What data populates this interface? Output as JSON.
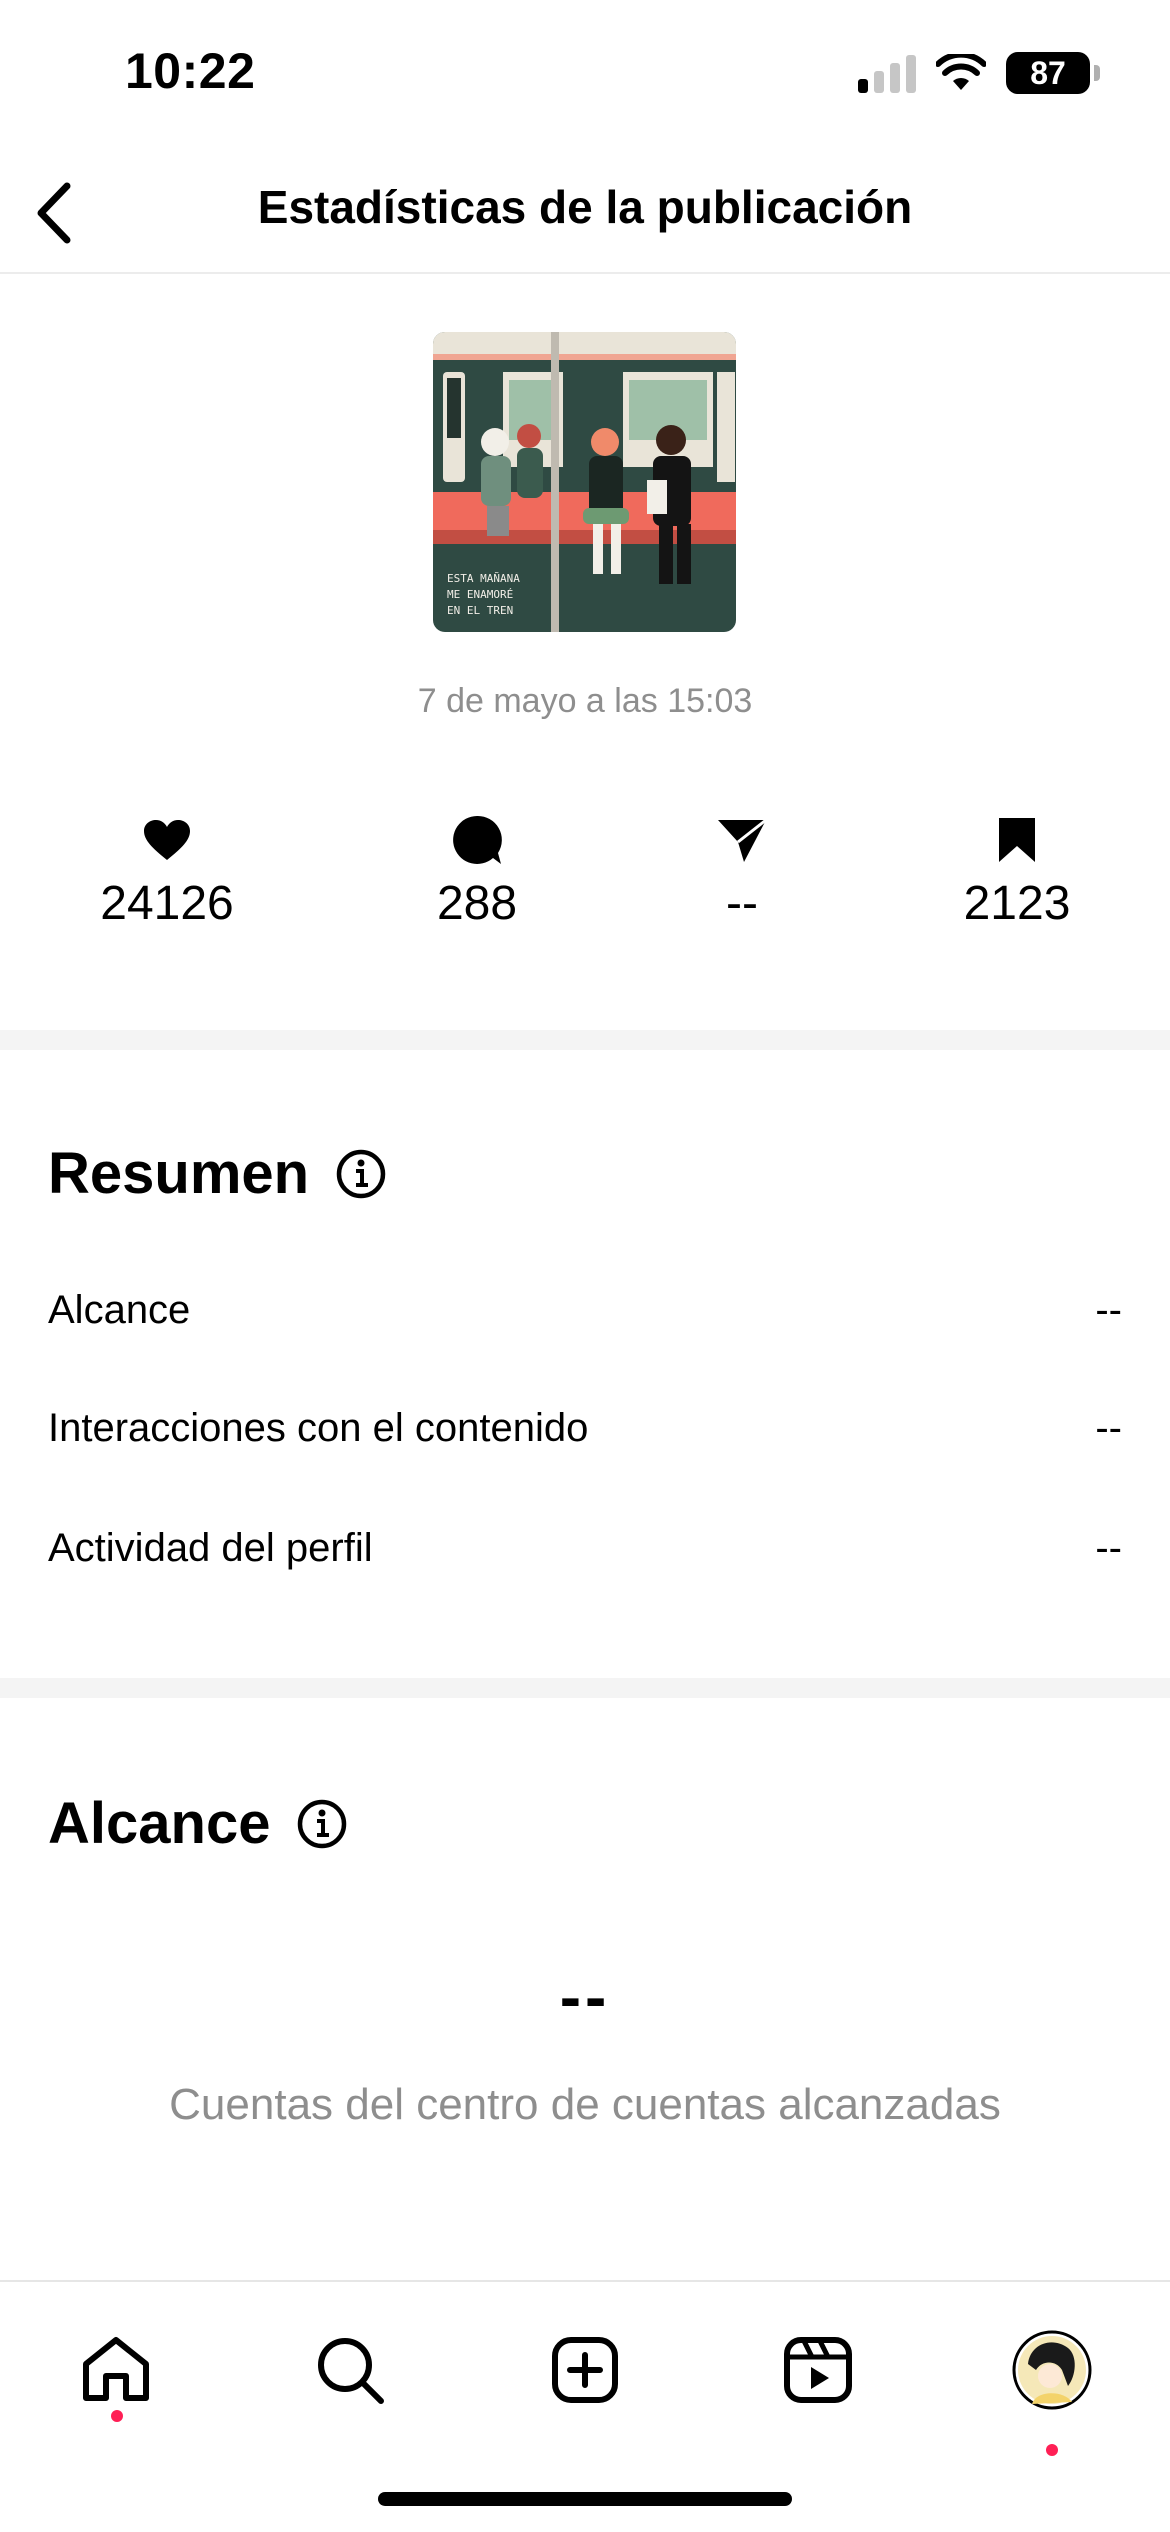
{
  "status_bar": {
    "time": "10:22",
    "battery": "87"
  },
  "header": {
    "title": "Estadísticas de la publicación"
  },
  "post": {
    "thumbnail_caption": "ESTA MAÑANA ME ENAMORÉ EN EL TREN",
    "date": "7 de mayo a las 15:03"
  },
  "metrics": [
    {
      "icon": "heart-icon",
      "value": "24126"
    },
    {
      "icon": "comment-icon",
      "value": "288"
    },
    {
      "icon": "share-icon",
      "value": "--"
    },
    {
      "icon": "bookmark-icon",
      "value": "2123"
    }
  ],
  "summary": {
    "title": "Resumen",
    "rows": [
      {
        "label": "Alcance",
        "value": "--"
      },
      {
        "label": "Interacciones con el contenido",
        "value": "--"
      },
      {
        "label": "Actividad del perfil",
        "value": "--"
      }
    ]
  },
  "reach": {
    "title": "Alcance",
    "value": "--",
    "label": "Cuentas del centro de cuentas alcanzadas"
  },
  "bottom_nav": [
    "home-icon",
    "search-icon",
    "create-icon",
    "reels-icon",
    "profile-avatar"
  ],
  "colors": {
    "notification_dot": "#ff1f55",
    "secondary_text": "#8e8e8e",
    "thumb_bg": "#2f4a43",
    "seat": "#f06a5c"
  }
}
